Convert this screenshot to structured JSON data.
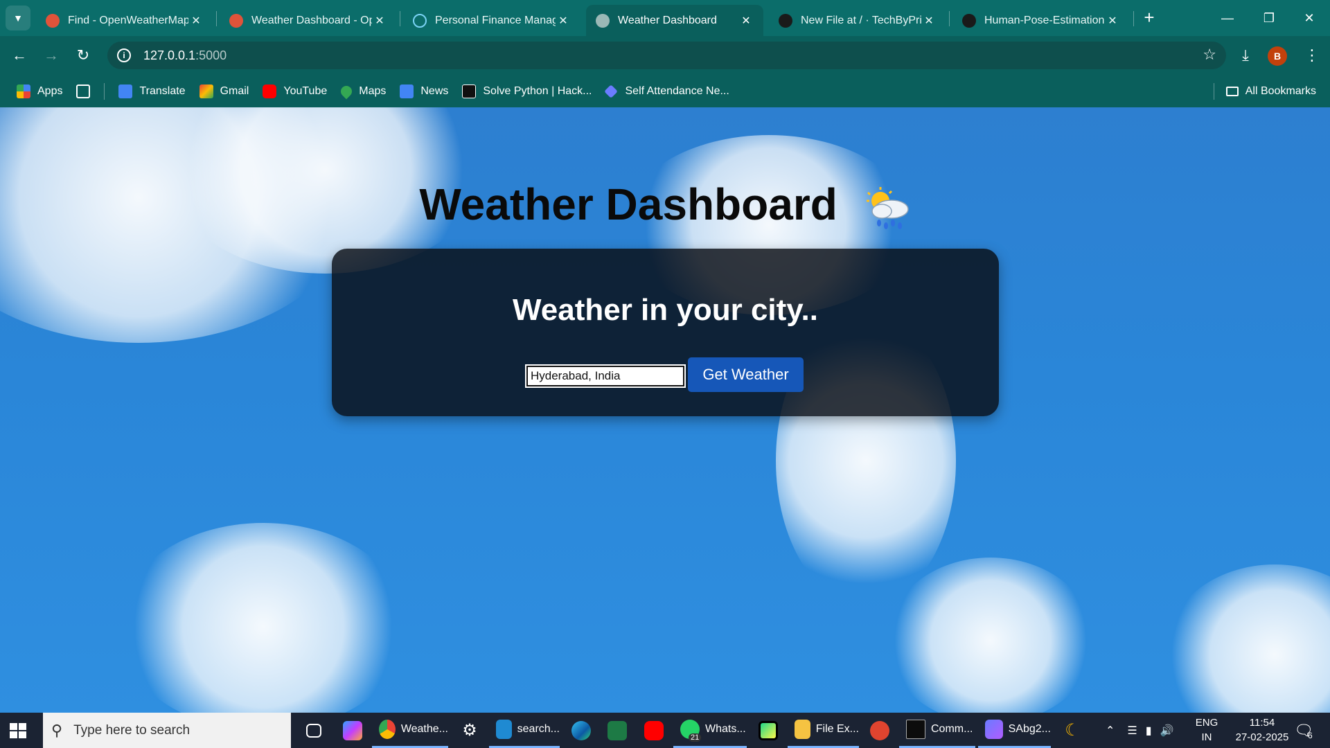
{
  "browser": {
    "tabs": [
      {
        "title": "Find - OpenWeatherMap",
        "favicon_color": "#e0533a",
        "active": false
      },
      {
        "title": "Weather Dashboard - Op",
        "favicon_color": "#e0533a",
        "active": false
      },
      {
        "title": "Personal Finance Manage",
        "favicon_color": "#7ad3f5",
        "active": false
      },
      {
        "title": "Weather Dashboard",
        "favicon_color": "#9bb8b6",
        "active": true
      },
      {
        "title": "New File at / · TechByPriy",
        "favicon_color": "#1a1a1a",
        "active": false
      },
      {
        "title": "Human-Pose-Estimation-",
        "favicon_color": "#1a1a1a",
        "active": false
      }
    ],
    "new_tab_symbol": "+",
    "window_controls": {
      "minimize": "—",
      "restore": "❐",
      "close": "✕"
    },
    "address": {
      "host": "127.0.0.1",
      "port": ":5000"
    },
    "profile_initial": "B",
    "bookmarks": [
      {
        "label": "Apps",
        "icon": "apps-grid-icon",
        "color": "#4285f4"
      },
      {
        "label": "",
        "icon": "tab-groups-icon",
        "color": "#ffffff"
      },
      {
        "label": "Translate",
        "icon": "google-translate-icon",
        "color": "#4285f4"
      },
      {
        "label": "Gmail",
        "icon": "gmail-icon",
        "color": "#ea4335"
      },
      {
        "label": "YouTube",
        "icon": "youtube-icon",
        "color": "#ff0000"
      },
      {
        "label": "Maps",
        "icon": "maps-icon",
        "color": "#34a853"
      },
      {
        "label": "News",
        "icon": "google-news-icon",
        "color": "#4285f4"
      },
      {
        "label": "Solve Python | Hack...",
        "icon": "hackerrank-icon",
        "color": "#111111"
      },
      {
        "label": "Self Attendance Ne...",
        "icon": "attendance-icon",
        "color": "#6b7cff"
      }
    ],
    "all_bookmarks_label": "All Bookmarks"
  },
  "page": {
    "heading": "Weather Dashboard",
    "heading_emoji": "sun-behind-rain-cloud-icon",
    "panel_title": "Weather in your city..",
    "city_input_value": "Hyderabad, India",
    "submit_label": "Get Weather",
    "colors": {
      "button": "#1657b8",
      "panel": "rgba(8,12,20,0.82)",
      "sky": "#2a86d8"
    }
  },
  "taskbar": {
    "search_placeholder": "Type here to search",
    "items": [
      {
        "label": "",
        "icon": "task-view-icon"
      },
      {
        "label": "",
        "icon": "copilot-icon"
      },
      {
        "label": "Weathe...",
        "icon": "chrome-icon",
        "running": true
      },
      {
        "label": "",
        "icon": "settings-icon"
      },
      {
        "label": "search...",
        "icon": "vscode-icon",
        "running": true
      },
      {
        "label": "",
        "icon": "edge-icon"
      },
      {
        "label": "",
        "icon": "excel-icon"
      },
      {
        "label": "",
        "icon": "youtube-icon"
      },
      {
        "label": "Whats...",
        "icon": "whatsapp-icon",
        "running": true,
        "badge": "21"
      },
      {
        "label": "",
        "icon": "pycharm-icon"
      },
      {
        "label": "File Ex...",
        "icon": "file-explorer-icon",
        "running": true
      },
      {
        "label": "",
        "icon": "wps-office-icon"
      },
      {
        "label": "Comm...",
        "icon": "command-prompt-icon",
        "running": true
      },
      {
        "label": "SAbg2...",
        "icon": "photos-icon",
        "running": true
      },
      {
        "label": "",
        "icon": "night-mode-icon"
      }
    ],
    "lang_top": "ENG",
    "lang_bottom": "IN",
    "time": "11:54",
    "date": "27-02-2025",
    "notification_count": "6"
  }
}
